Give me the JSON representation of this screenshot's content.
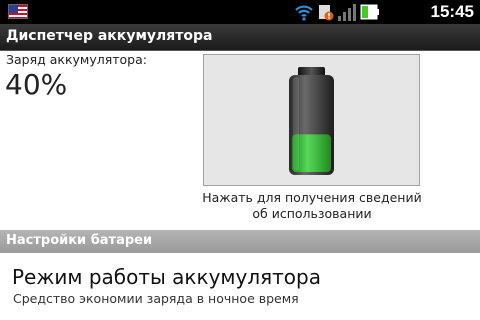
{
  "status_bar": {
    "time": "15:45",
    "icons": [
      "us-flag-icon",
      "wifi-icon",
      "warning-icon",
      "signal-icon",
      "battery-icon"
    ],
    "battery_level": 0.4
  },
  "title_bar": {
    "title": "Диспетчер аккумулятора"
  },
  "battery": {
    "charge_label": "Заряд аккумулятора:",
    "charge_value": "40%",
    "level": 0.4,
    "caption": "Нажать для получения сведений об использовании"
  },
  "settings": {
    "header": "Настройки батареи",
    "items": [
      {
        "title": "Режим работы аккумулятора",
        "summary": "Средство экономии заряда в ночное время"
      }
    ]
  },
  "colors": {
    "battery_fill": "#3cb83c",
    "section_header": "#a8a8a8",
    "title_bar": "#2a2a2a"
  }
}
